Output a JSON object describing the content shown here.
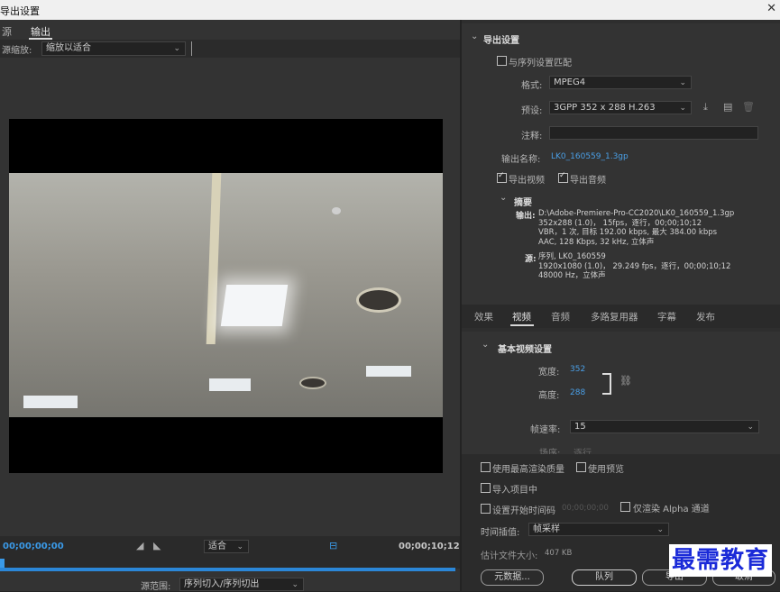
{
  "window": {
    "title": "导出设置",
    "close_glyph": "✕"
  },
  "left": {
    "tabs": [
      "源",
      "输出"
    ],
    "source_scale_label": "源缩放:",
    "source_scale_value": "缩放以适合",
    "timecode_start": "00;00;00;00",
    "fit_value": "适合",
    "timecode_end": "00;00;10;12",
    "range_label": "源范围:",
    "range_value": "序列切入/序列切出"
  },
  "export_settings": {
    "header": "导出设置",
    "match_sequence": "与序列设置匹配",
    "format_label": "格式:",
    "format_value": "MPEG4",
    "preset_label": "预设:",
    "preset_value": "3GPP 352 x 288 H.263",
    "comment_label": "注释:",
    "output_name_label": "输出名称:",
    "output_name_value": "LK0_160559_1.3gp",
    "export_video": "导出视频",
    "export_audio": "导出音频",
    "summary_header": "摘要",
    "output_label": "输出:",
    "output_lines": [
      "D:\\Adobe-Premiere-Pro-CC2020\\LK0_160559_1.3gp",
      "352x288 (1.0)， 15fps，逐行，00;00;10;12",
      "VBR，1 次, 目标 192.00 kbps, 最大 384.00 kbps",
      "AAC, 128 Kbps, 32  kHz, 立体声"
    ],
    "source_label": "源:",
    "source_lines": [
      "序列, LK0_160559",
      "1920x1080 (1.0)， 29.249 fps，逐行，00;00;10;12",
      "48000 Hz，立体声"
    ]
  },
  "tabs2": [
    "效果",
    "视频",
    "音频",
    "多路复用器",
    "字幕",
    "发布"
  ],
  "video": {
    "header": "基本视频设置",
    "width_label": "宽度:",
    "width_value": "352",
    "height_label": "高度:",
    "height_value": "288",
    "fps_label": "帧速率:",
    "fps_value": "15",
    "field_label": "场序:",
    "field_value": "逐行"
  },
  "bottom": {
    "max_quality": "使用最高渲染质量",
    "use_preview": "使用预览",
    "import_project": "导入项目中",
    "set_start_tc": "设置开始时间码",
    "start_tc_value": "00;00;00;00",
    "alpha_only": "仅渲染 Alpha 通道",
    "interp_label": "时间插值:",
    "interp_value": "帧采样",
    "filesize_label": "估计文件大小:",
    "filesize_value": "407 KB",
    "metadata_btn": "元数据...",
    "queue_btn": "队列",
    "export_btn": "导出",
    "cancel_btn": "取消"
  },
  "watermark": "最需教育"
}
